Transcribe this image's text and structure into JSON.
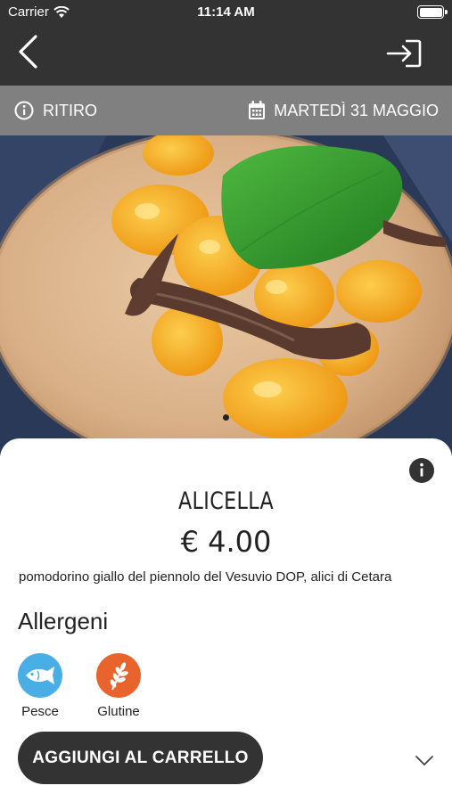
{
  "status_bar": {
    "carrier": "Carrier",
    "time": "11:14 AM",
    "battery_level": 1.0
  },
  "nav": {
    "back_icon": "chevron-left-icon",
    "login_icon": "sign-in-icon"
  },
  "order_info": {
    "mode_label": "RITIRO",
    "mode_icon": "info-icon",
    "date_label": "MARTEDÌ 31 MAGGIO",
    "date_icon": "calendar-icon"
  },
  "carousel": {
    "image_alt": "pizza fritta con pomodorini gialli, alici e basilico",
    "page_count": 1,
    "active_page": 1
  },
  "product": {
    "name": "ALICELLA",
    "price": "€ 4.00",
    "description": "pomodorino giallo del piennolo del Vesuvio DOP, alici di Cetara"
  },
  "allergens": {
    "title": "Allergeni",
    "items": [
      {
        "label": "Pesce",
        "icon": "fish-icon",
        "color": "#4aaee6"
      },
      {
        "label": "Glutine",
        "icon": "wheat-icon",
        "color": "#e8642c"
      }
    ]
  },
  "actions": {
    "add_to_cart_label": "AGGIUNGI AL CARRELLO",
    "expand_icon": "chevron-down-icon"
  },
  "colors": {
    "header_bg": "#333333",
    "info_bar_bg": "#808080",
    "button_bg": "#333333"
  }
}
